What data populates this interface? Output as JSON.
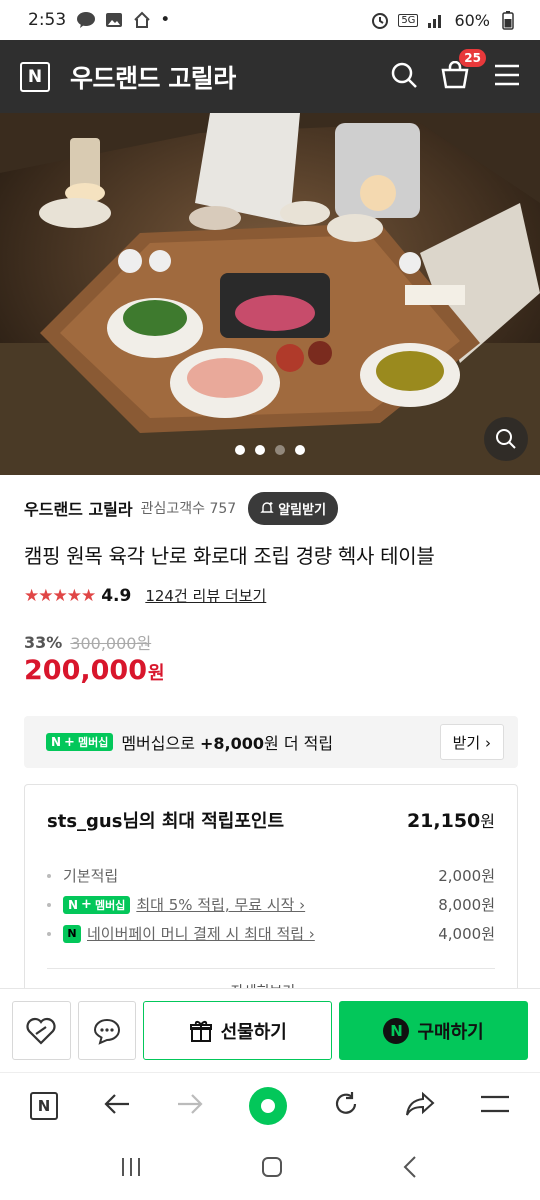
{
  "status_bar": {
    "time": "2:53",
    "dot": "•",
    "network": "5G",
    "battery": "60%"
  },
  "header": {
    "logo": "N",
    "title": "우드랜드 고릴라",
    "cart_count": "25",
    "bg_color": "#2f2f2f"
  },
  "hero": {
    "image_description_icon": "zoom-icon",
    "carousel_count": 4,
    "carousel_active_index": 2
  },
  "store": {
    "name": "우드랜드 고릴라",
    "followers": "관심고객수 757",
    "alarm_label": "알림받기"
  },
  "product": {
    "title": "캠핑 원목 육각 난로 화로대 조립 경량 헥사 테이블",
    "stars": "★★★★★",
    "rating": "4.9",
    "review_link": "124건 리뷰 더보기",
    "discount": "33%",
    "original_price": "300,000원",
    "sale_price": "200,000",
    "sale_currency": "원",
    "price_color": "#d8162c"
  },
  "membership": {
    "badge_n": "N",
    "badge_plus": "+",
    "badge_label": "멤버십",
    "text_prefix": "멤버십으로 ",
    "text_amount": "+8,000",
    "text_suffix": "원 더 적립",
    "receive_label": "받기 ›"
  },
  "points": {
    "title": "sts_gus님의 최대 적립포인트",
    "total": "21,150",
    "total_unit": "원",
    "rows": [
      {
        "label": "기본적립",
        "amount": "2,000원"
      },
      {
        "label": "최대 5% 적립, 무료 시작 ›",
        "amount": "8,000원"
      },
      {
        "label": "네이버페이 머니 결제 시 최대 적립 ›",
        "amount": "4,000원"
      }
    ],
    "npay_badge": "N",
    "more_label": "자세히보기 ⌄"
  },
  "actions": {
    "gift_label": "선물하기",
    "buy_label": "구매하기",
    "buy_n": "N",
    "brand_green": "#03c75a"
  },
  "browser_nav": {
    "logo": "N"
  }
}
